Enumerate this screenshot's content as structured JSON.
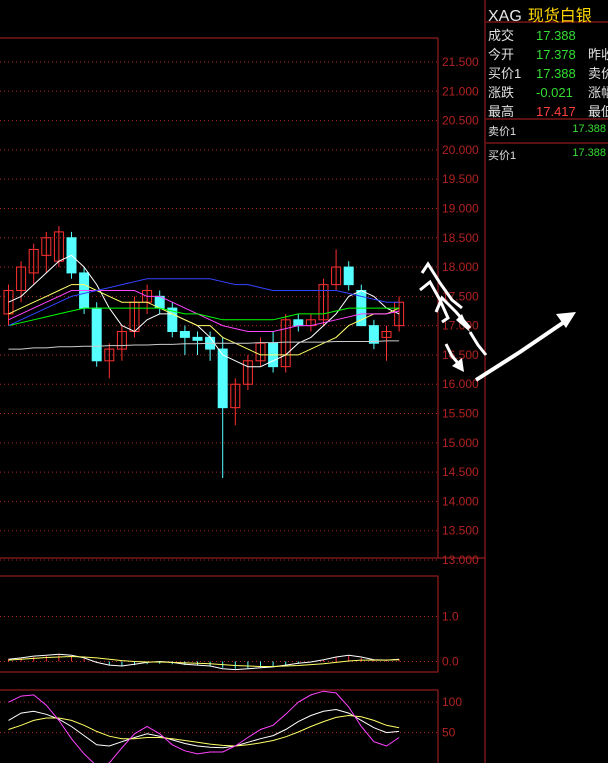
{
  "quote": {
    "symbol": "XAG",
    "name": "现货白银",
    "rows": [
      {
        "label": "成交",
        "value": "17.388",
        "color": "green",
        "label2": ""
      },
      {
        "label": "今开",
        "value": "17.378",
        "color": "green",
        "label2": "昨收"
      },
      {
        "label": "买价1",
        "value": "17.388",
        "color": "green",
        "label2": "卖价"
      },
      {
        "label": "涨跌",
        "value": "-0.021",
        "color": "green",
        "label2": "涨幅"
      },
      {
        "label": "最高",
        "value": "17.417",
        "color": "red",
        "label2": "最低"
      }
    ],
    "orderbook": [
      {
        "label": "卖价1",
        "value": "17.388"
      },
      {
        "label": "买价1",
        "value": "17.388"
      }
    ]
  },
  "price_axis": [
    "21.500",
    "21.000",
    "20.500",
    "20.000",
    "19.500",
    "19.000",
    "18.500",
    "18.000",
    "17.500",
    "17.000",
    "16.500",
    "16.000",
    "15.500",
    "15.000",
    "14.500",
    "14.000",
    "13.500",
    "13.000"
  ],
  "macd_axis": [
    "1.0",
    "0.0"
  ],
  "kdj_axis": [
    "100",
    "50"
  ],
  "colors": {
    "up": "#ff3030",
    "down": "#55ffff",
    "grid": "#b22222",
    "ma5": "#ffffff",
    "ma10": "#ffff66",
    "ma20": "#ff44ff",
    "ma30": "#00ff00",
    "ma60": "#3344ff",
    "ma120": "#cccccc"
  },
  "chart_data": {
    "type": "candlestick",
    "ylim": [
      13.0,
      21.5
    ],
    "candles": [
      {
        "o": 17.2,
        "h": 17.7,
        "l": 17.0,
        "c": 17.6
      },
      {
        "o": 17.6,
        "h": 18.1,
        "l": 17.4,
        "c": 18.0
      },
      {
        "o": 17.9,
        "h": 18.4,
        "l": 17.7,
        "c": 18.3
      },
      {
        "o": 18.2,
        "h": 18.6,
        "l": 17.9,
        "c": 18.5
      },
      {
        "o": 18.1,
        "h": 18.7,
        "l": 18.0,
        "c": 18.6
      },
      {
        "o": 18.5,
        "h": 18.6,
        "l": 17.8,
        "c": 17.9
      },
      {
        "o": 17.9,
        "h": 18.0,
        "l": 17.2,
        "c": 17.3
      },
      {
        "o": 17.3,
        "h": 17.4,
        "l": 16.3,
        "c": 16.4
      },
      {
        "o": 16.4,
        "h": 16.7,
        "l": 16.1,
        "c": 16.6
      },
      {
        "o": 16.6,
        "h": 17.0,
        "l": 16.4,
        "c": 16.9
      },
      {
        "o": 16.9,
        "h": 17.5,
        "l": 16.8,
        "c": 17.4
      },
      {
        "o": 17.4,
        "h": 17.7,
        "l": 17.2,
        "c": 17.6
      },
      {
        "o": 17.5,
        "h": 17.6,
        "l": 17.2,
        "c": 17.3
      },
      {
        "o": 17.3,
        "h": 17.4,
        "l": 16.8,
        "c": 16.9
      },
      {
        "o": 16.9,
        "h": 17.0,
        "l": 16.5,
        "c": 16.8
      },
      {
        "o": 16.8,
        "h": 16.9,
        "l": 16.5,
        "c": 16.75
      },
      {
        "o": 16.8,
        "h": 16.9,
        "l": 16.4,
        "c": 16.6
      },
      {
        "o": 16.6,
        "h": 16.8,
        "l": 14.4,
        "c": 15.6
      },
      {
        "o": 15.6,
        "h": 16.1,
        "l": 15.3,
        "c": 16.0
      },
      {
        "o": 16.0,
        "h": 16.5,
        "l": 15.9,
        "c": 16.4
      },
      {
        "o": 16.4,
        "h": 16.8,
        "l": 16.3,
        "c": 16.7
      },
      {
        "o": 16.7,
        "h": 16.9,
        "l": 16.2,
        "c": 16.3
      },
      {
        "o": 16.3,
        "h": 17.2,
        "l": 16.2,
        "c": 17.1
      },
      {
        "o": 17.1,
        "h": 17.2,
        "l": 16.9,
        "c": 17.0
      },
      {
        "o": 17.0,
        "h": 17.2,
        "l": 16.9,
        "c": 17.1
      },
      {
        "o": 17.1,
        "h": 17.8,
        "l": 17.0,
        "c": 17.7
      },
      {
        "o": 17.7,
        "h": 18.3,
        "l": 17.6,
        "c": 18.0
      },
      {
        "o": 18.0,
        "h": 18.1,
        "l": 17.6,
        "c": 17.7
      },
      {
        "o": 17.6,
        "h": 17.7,
        "l": 17.0,
        "c": 17.0
      },
      {
        "o": 17.0,
        "h": 17.1,
        "l": 16.6,
        "c": 16.7
      },
      {
        "o": 16.8,
        "h": 17.0,
        "l": 16.4,
        "c": 16.9
      },
      {
        "o": 17.0,
        "h": 17.5,
        "l": 16.9,
        "c": 17.4
      }
    ],
    "ma": [
      {
        "key": "ma5",
        "values": [
          17.4,
          17.5,
          17.7,
          17.9,
          18.1,
          18.2,
          18.0,
          17.7,
          17.3,
          17.0,
          16.9,
          17.1,
          17.2,
          17.2,
          17.1,
          17.0,
          16.8,
          16.5,
          16.4,
          16.3,
          16.3,
          16.4,
          16.5,
          16.7,
          16.8,
          17.0,
          17.2,
          17.5,
          17.6,
          17.5,
          17.3,
          17.2
        ]
      },
      {
        "key": "ma10",
        "values": [
          17.2,
          17.3,
          17.4,
          17.5,
          17.6,
          17.7,
          17.7,
          17.6,
          17.5,
          17.4,
          17.4,
          17.4,
          17.3,
          17.2,
          17.1,
          17.0,
          17.0,
          16.8,
          16.7,
          16.6,
          16.5,
          16.5,
          16.5,
          16.5,
          16.6,
          16.7,
          16.8,
          17.0,
          17.1,
          17.2,
          17.2,
          17.3
        ]
      },
      {
        "key": "ma20",
        "values": [
          17.1,
          17.2,
          17.3,
          17.4,
          17.5,
          17.6,
          17.6,
          17.6,
          17.6,
          17.6,
          17.6,
          17.5,
          17.5,
          17.4,
          17.3,
          17.2,
          17.1,
          17.0,
          16.95,
          16.9,
          16.9,
          16.9,
          16.95,
          17.0,
          17.0,
          17.05,
          17.1,
          17.15,
          17.2,
          17.2,
          17.2,
          17.25
        ]
      },
      {
        "key": "ma30",
        "values": [
          17.0,
          17.05,
          17.1,
          17.15,
          17.2,
          17.25,
          17.3,
          17.3,
          17.3,
          17.3,
          17.3,
          17.3,
          17.3,
          17.25,
          17.2,
          17.2,
          17.15,
          17.1,
          17.1,
          17.1,
          17.1,
          17.1,
          17.15,
          17.2,
          17.2,
          17.2,
          17.25,
          17.3,
          17.3,
          17.3,
          17.3,
          17.3
        ]
      },
      {
        "key": "ma60",
        "values": [
          17.0,
          17.1,
          17.2,
          17.3,
          17.4,
          17.5,
          17.55,
          17.6,
          17.65,
          17.7,
          17.75,
          17.8,
          17.8,
          17.8,
          17.8,
          17.8,
          17.8,
          17.75,
          17.7,
          17.7,
          17.65,
          17.6,
          17.6,
          17.6,
          17.6,
          17.6,
          17.6,
          17.55,
          17.5,
          17.45,
          17.4,
          17.4
        ]
      },
      {
        "key": "ma120",
        "values": [
          16.6,
          16.6,
          16.62,
          16.62,
          16.64,
          16.64,
          16.65,
          16.65,
          16.66,
          16.66,
          16.67,
          16.67,
          16.68,
          16.68,
          16.69,
          16.69,
          16.7,
          16.7,
          16.7,
          16.7,
          16.71,
          16.71,
          16.72,
          16.72,
          16.72,
          16.72,
          16.73,
          16.73,
          16.73,
          16.73,
          16.74,
          16.74
        ]
      }
    ],
    "macd_ylim": [
      -0.5,
      1.5
    ],
    "macd": [
      0.05,
      0.08,
      0.1,
      0.12,
      0.14,
      0.12,
      0.06,
      -0.02,
      -0.08,
      -0.1,
      -0.08,
      -0.06,
      -0.05,
      -0.06,
      -0.08,
      -0.09,
      -0.1,
      -0.14,
      -0.16,
      -0.15,
      -0.13,
      -0.12,
      -0.08,
      -0.05,
      -0.02,
      0.04,
      0.1,
      0.12,
      0.08,
      0.02,
      0.03,
      0.05
    ],
    "dif": [
      0.05,
      0.08,
      0.12,
      0.14,
      0.16,
      0.14,
      0.08,
      -0.02,
      -0.08,
      -0.1,
      -0.06,
      -0.02,
      0.0,
      -0.02,
      -0.06,
      -0.08,
      -0.1,
      -0.16,
      -0.18,
      -0.16,
      -0.14,
      -0.12,
      -0.08,
      -0.04,
      -0.01,
      0.04,
      0.1,
      0.14,
      0.1,
      0.04,
      0.03,
      0.05
    ],
    "dea": [
      0.03,
      0.05,
      0.07,
      0.09,
      0.1,
      0.11,
      0.1,
      0.08,
      0.05,
      0.02,
      0.0,
      -0.01,
      -0.01,
      -0.02,
      -0.03,
      -0.04,
      -0.05,
      -0.07,
      -0.09,
      -0.1,
      -0.11,
      -0.11,
      -0.1,
      -0.09,
      -0.07,
      -0.05,
      -0.02,
      0.01,
      0.03,
      0.03,
      0.03,
      0.04
    ],
    "kdj_ylim": [
      0,
      120
    ],
    "k": [
      70,
      82,
      85,
      80,
      72,
      60,
      45,
      30,
      28,
      35,
      42,
      48,
      44,
      38,
      32,
      28,
      26,
      25,
      28,
      34,
      40,
      45,
      55,
      68,
      78,
      85,
      88,
      82,
      70,
      58,
      50,
      52
    ],
    "d": [
      55,
      62,
      70,
      74,
      74,
      70,
      62,
      52,
      44,
      40,
      40,
      42,
      42,
      40,
      37,
      34,
      31,
      29,
      28,
      30,
      33,
      37,
      43,
      51,
      60,
      68,
      75,
      78,
      76,
      70,
      62,
      58
    ],
    "j": [
      100,
      110,
      112,
      95,
      70,
      40,
      15,
      -5,
      0,
      25,
      48,
      60,
      48,
      30,
      20,
      15,
      18,
      18,
      28,
      42,
      55,
      62,
      80,
      100,
      112,
      118,
      115,
      92,
      60,
      35,
      28,
      42
    ]
  }
}
